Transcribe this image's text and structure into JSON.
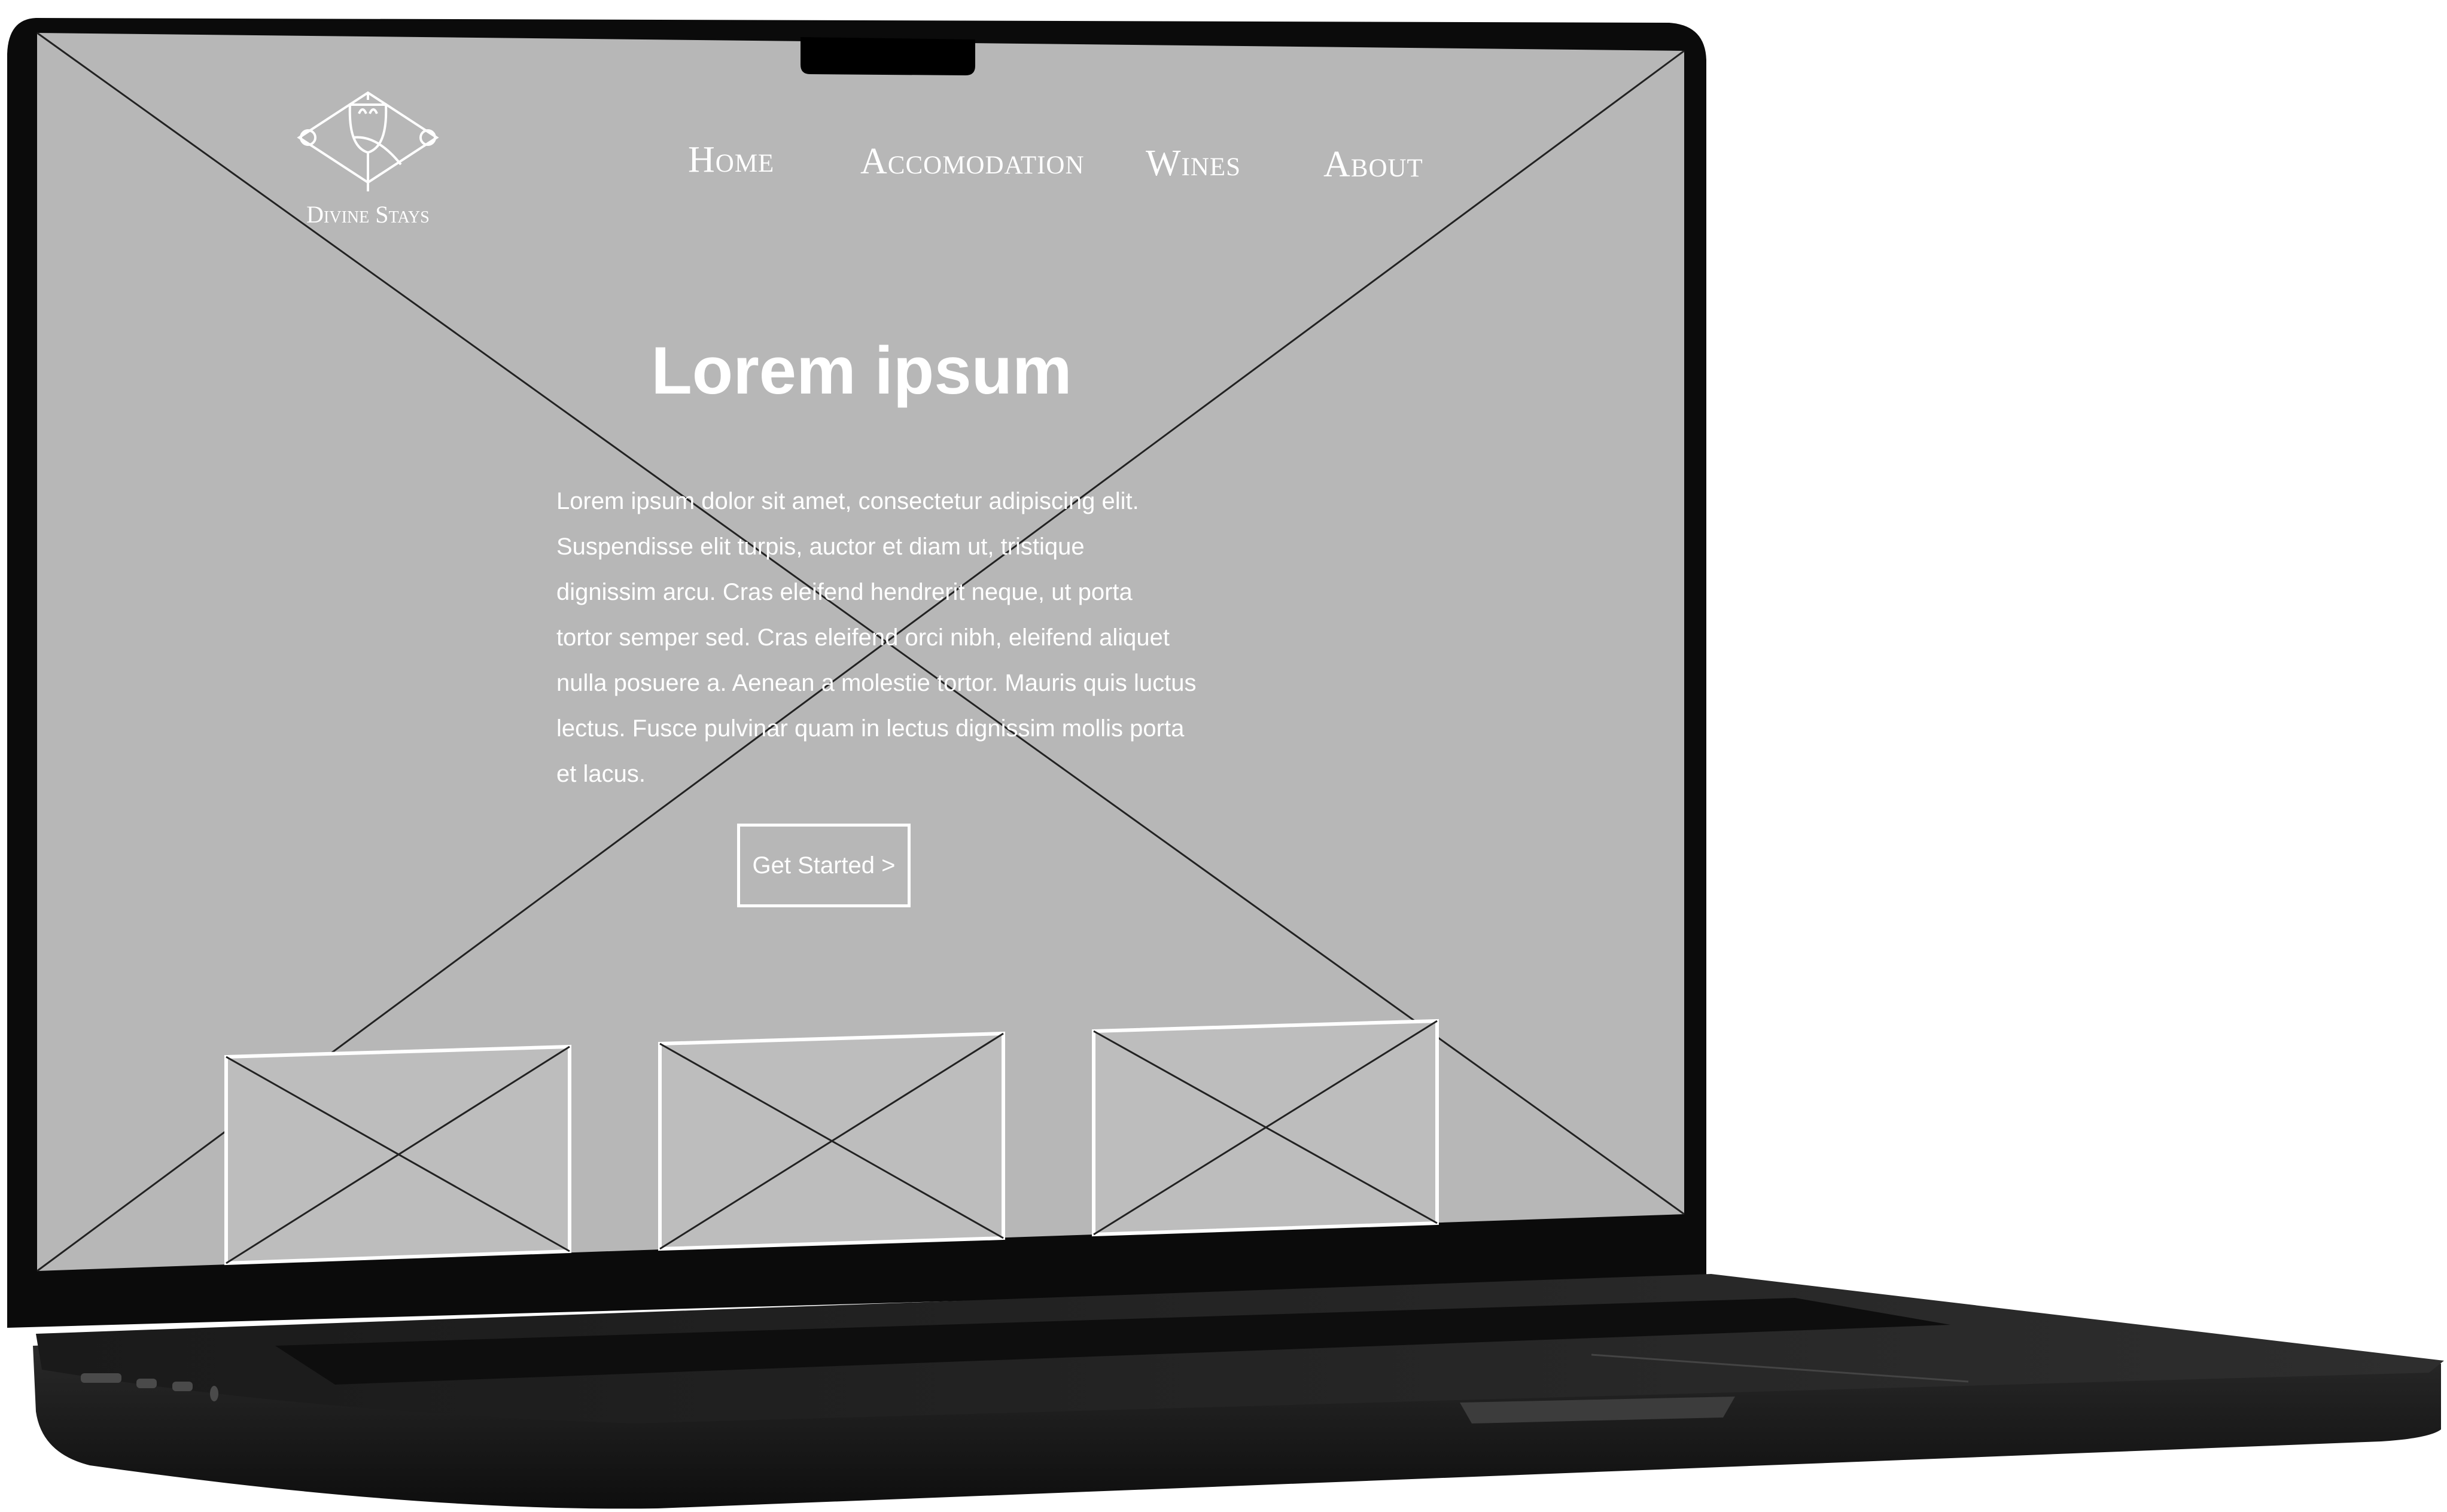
{
  "logo": {
    "text": "Divine Stays",
    "icon": "wine-glass-hills-logo"
  },
  "nav": {
    "items": [
      {
        "label": "Home"
      },
      {
        "label": "Accomodation"
      },
      {
        "label": "Wines"
      },
      {
        "label": "About"
      }
    ]
  },
  "hero": {
    "title": "Lorem ipsum",
    "body_lines": [
      "Lorem ipsum dolor sit amet, consectetur adipiscing elit.",
      "Suspendisse elit turpis, auctor et diam ut, tristique",
      "dignissim arcu. Cras eleifend hendrerit neque, ut porta",
      "tortor semper sed. Cras eleifend orci nibh, eleifend aliquet",
      "nulla posuere a. Aenean a molestie tortor. Mauris quis luctus",
      "lectus. Fusce pulvinar quam in lectus dignissim mollis porta",
      "et lacus."
    ],
    "cta_label": "Get Started >"
  },
  "cards": [
    {
      "type": "image-placeholder"
    },
    {
      "type": "image-placeholder"
    },
    {
      "type": "image-placeholder"
    }
  ],
  "colors": {
    "screen_bg": "#b7b7b7",
    "card_bg": "#bdbdbd",
    "text": "#ffffff",
    "laptop_body": "#111111",
    "laptop_base": "#2b2b2b"
  }
}
